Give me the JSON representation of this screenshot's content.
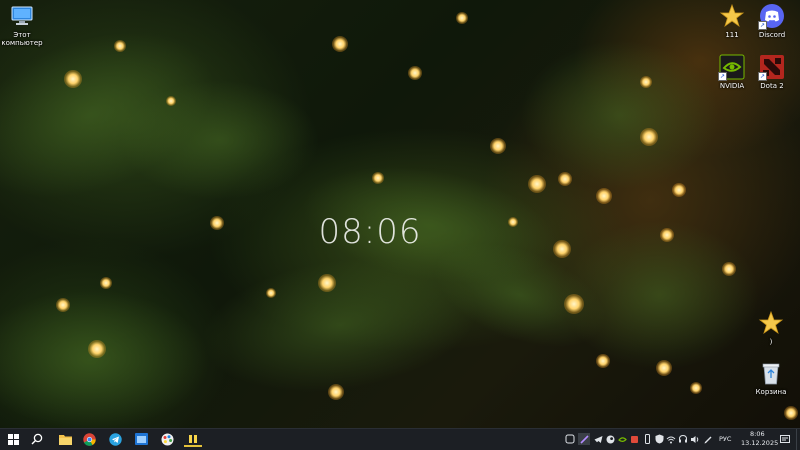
{
  "wallpaper": {
    "clock": "08:06"
  },
  "desktop_icons": {
    "this_pc": "Этот компьютер",
    "star1": "111",
    "discord": "Discord",
    "nvidia": "NVIDIA",
    "dota": "Dota 2",
    "star2": ")",
    "recycle": "Корзина"
  },
  "taskbar": {
    "language": "РУС",
    "time": "8:06",
    "date": "13.12.2025"
  },
  "colors": {
    "taskbar_bg": "#1c1f24",
    "discord": "#5865f2",
    "nvidia": "#76b900",
    "dota": "#b3261e"
  }
}
